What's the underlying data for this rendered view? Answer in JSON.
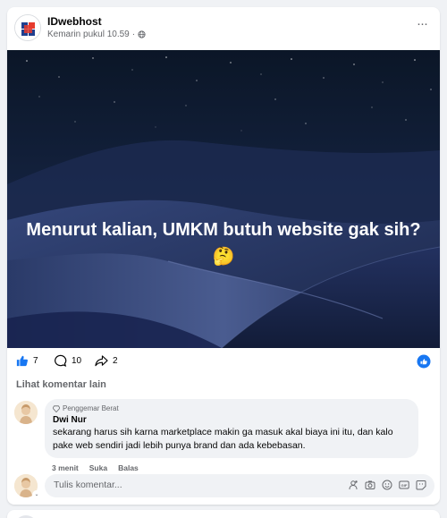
{
  "post": {
    "page_name": "IDwebhost",
    "timestamp": "Kemarin pukul 10.59",
    "separator": "·",
    "privacy_icon": "globe-icon",
    "more_icon": "more-options-icon",
    "more_label": "···",
    "image_text": "Menurut kalian, UMKM butuh website gak sih? 🤔"
  },
  "reactions": {
    "like_count": "7",
    "comment_count": "10",
    "share_count": "2",
    "like_icon": "thumbs-up-icon",
    "comment_icon": "comment-bubble-icon",
    "share_icon": "share-arrow-icon",
    "right_icon": "share-circle-icon"
  },
  "comments": {
    "see_more_label": "Lihat komentar lain",
    "items": [
      {
        "badge": "Penggemar Berat",
        "author": "Dwi Nur",
        "text": "sekarang harus sih karna marketplace makin ga masuk akal biaya ini itu, dan kalo pake web sendiri jadi lebih punya brand dan ada kebebasan.",
        "time": "3 menit",
        "like_label": "Suka",
        "reply_label": "Balas"
      }
    ]
  },
  "composer": {
    "placeholder": "Tulis komentar...",
    "caret": "⌄",
    "tools": [
      "avatar-sticker-icon",
      "camera-icon",
      "emoji-icon",
      "gif-icon",
      "sticker-icon"
    ]
  },
  "colors": {
    "accent": "#1877f2",
    "muted_text": "#65676b",
    "bubble_bg": "#f0f2f5",
    "page_bg": "#f0f2f5"
  }
}
